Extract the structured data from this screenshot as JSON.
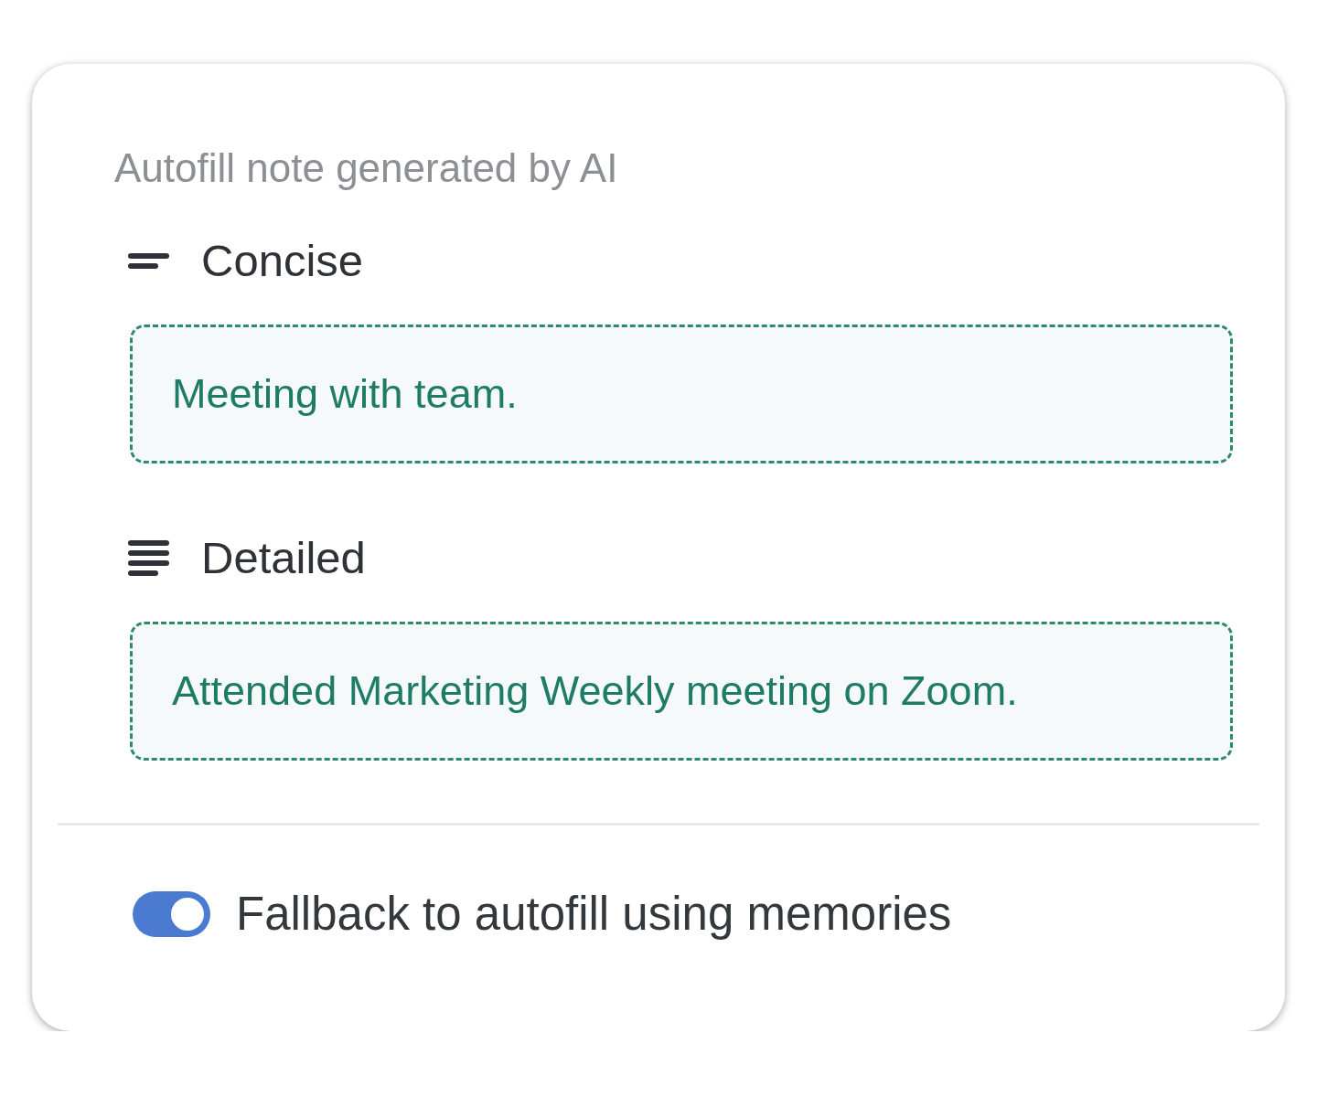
{
  "header": {
    "title": "Autofill note generated by AI"
  },
  "options": [
    {
      "kind": "concise",
      "label": "Concise",
      "note": "Meeting with team."
    },
    {
      "kind": "detailed",
      "label": "Detailed",
      "note": "Attended Marketing Weekly meeting on Zoom."
    }
  ],
  "fallback": {
    "label": "Fallback to autofill using memories",
    "on": true
  }
}
